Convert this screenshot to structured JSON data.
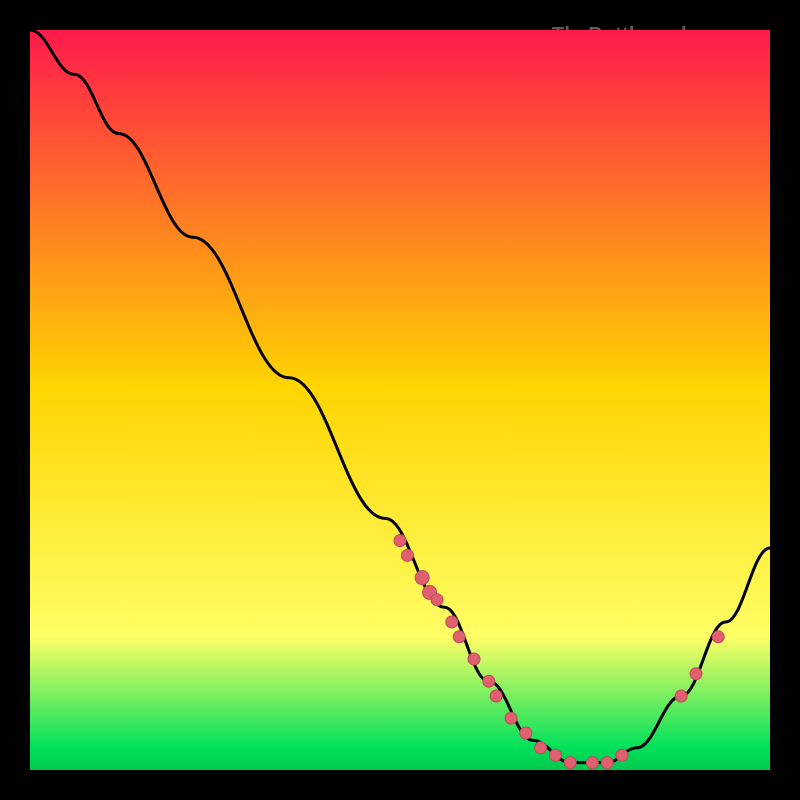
{
  "attribution": "TheBottlenecker.com",
  "chart_data": {
    "type": "line",
    "title": "",
    "xlabel": "",
    "ylabel": "",
    "xlim": [
      0,
      100
    ],
    "ylim": [
      0,
      100
    ],
    "gradient_top": "#ff1a4b",
    "gradient_mid": "#ffd400",
    "gradient_low": "#ffff66",
    "gradient_bottom": "#00e05a",
    "curve": [
      {
        "x": 0,
        "y": 100
      },
      {
        "x": 6,
        "y": 94
      },
      {
        "x": 12,
        "y": 86
      },
      {
        "x": 22,
        "y": 72
      },
      {
        "x": 35,
        "y": 53
      },
      {
        "x": 48,
        "y": 34
      },
      {
        "x": 56,
        "y": 22
      },
      {
        "x": 62,
        "y": 12
      },
      {
        "x": 68,
        "y": 4
      },
      {
        "x": 73,
        "y": 1
      },
      {
        "x": 78,
        "y": 1
      },
      {
        "x": 82,
        "y": 3
      },
      {
        "x": 88,
        "y": 10
      },
      {
        "x": 94,
        "y": 20
      },
      {
        "x": 100,
        "y": 30
      }
    ],
    "markers": [
      {
        "x": 50,
        "y": 31,
        "r": 6
      },
      {
        "x": 51,
        "y": 29,
        "r": 6
      },
      {
        "x": 53,
        "y": 26,
        "r": 7
      },
      {
        "x": 54,
        "y": 24,
        "r": 7
      },
      {
        "x": 55,
        "y": 23,
        "r": 6
      },
      {
        "x": 57,
        "y": 20,
        "r": 6
      },
      {
        "x": 58,
        "y": 18,
        "r": 6
      },
      {
        "x": 60,
        "y": 15,
        "r": 6
      },
      {
        "x": 62,
        "y": 12,
        "r": 6
      },
      {
        "x": 63,
        "y": 10,
        "r": 6
      },
      {
        "x": 65,
        "y": 7,
        "r": 6
      },
      {
        "x": 67,
        "y": 5,
        "r": 6
      },
      {
        "x": 69,
        "y": 3,
        "r": 6
      },
      {
        "x": 71,
        "y": 2,
        "r": 6
      },
      {
        "x": 73,
        "y": 1,
        "r": 6
      },
      {
        "x": 76,
        "y": 1,
        "r": 6
      },
      {
        "x": 78,
        "y": 1,
        "r": 6
      },
      {
        "x": 80,
        "y": 2,
        "r": 6
      },
      {
        "x": 88,
        "y": 10,
        "r": 6
      },
      {
        "x": 90,
        "y": 13,
        "r": 6
      },
      {
        "x": 93,
        "y": 18,
        "r": 6
      }
    ],
    "marker_fill": "#e06070",
    "marker_stroke": "#c04858"
  }
}
